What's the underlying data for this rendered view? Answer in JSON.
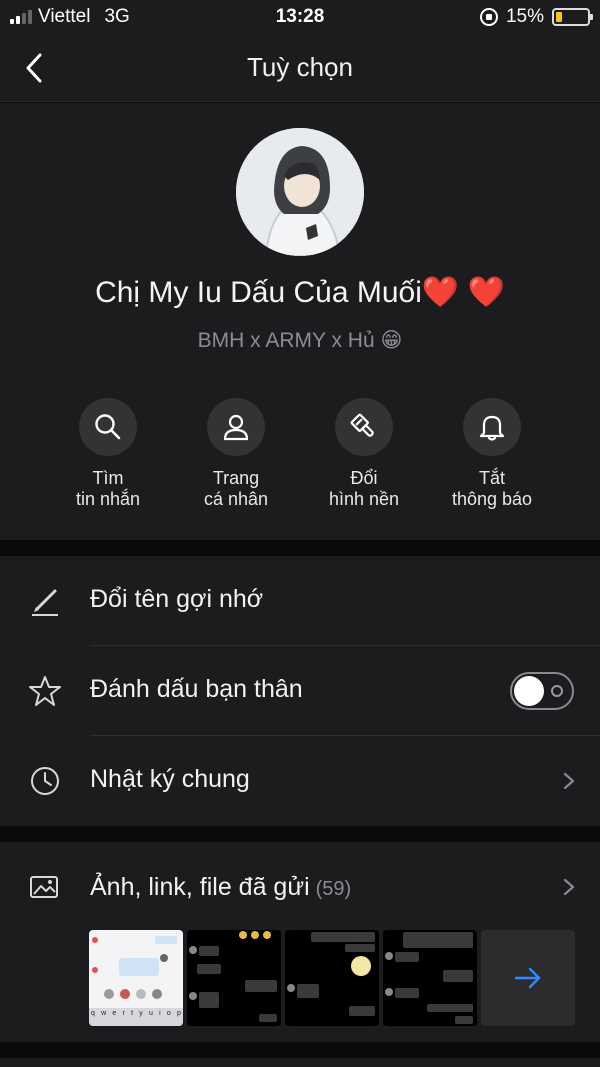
{
  "status_bar": {
    "carrier": "Viettel",
    "network": "3G",
    "time": "13:28",
    "battery": "15%"
  },
  "nav": {
    "title": "Tuỳ chọn"
  },
  "profile": {
    "name": "Chị My Iu Dấu Của Muối❤️ ❤️",
    "status": "BMH x ARMY x Hủ 😁"
  },
  "actions": [
    {
      "line1": "Tìm",
      "line2": "tin nhắn",
      "icon": "search-icon"
    },
    {
      "line1": "Trang",
      "line2": "cá nhân",
      "icon": "person-icon"
    },
    {
      "line1": "Đổi",
      "line2": "hình nền",
      "icon": "paint-brush-icon"
    },
    {
      "line1": "Tắt",
      "line2": "thông báo",
      "icon": "bell-icon"
    }
  ],
  "menu": {
    "rename": "Đổi tên gợi nhớ",
    "best_friend": "Đánh dấu bạn thân",
    "best_friend_on": false,
    "diary": "Nhật ký chung"
  },
  "media": {
    "label": "Ảnh, link, file đã gửi",
    "count": "(59)",
    "thumb_keys": [
      "q",
      "w",
      "e",
      "r",
      "t",
      "y",
      "u",
      "i",
      "o",
      "p"
    ]
  },
  "colors": {
    "background": "#1c1c1e",
    "accent": "#2d8cff",
    "battery": "#f7c417"
  }
}
